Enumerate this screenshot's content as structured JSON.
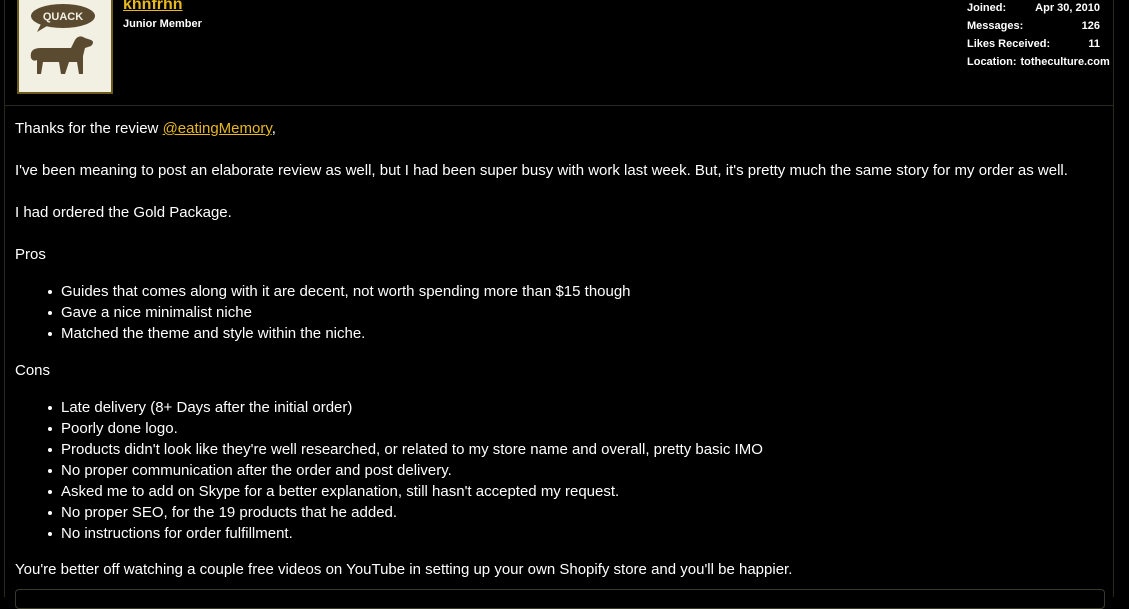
{
  "user": {
    "username": "khnfrhn",
    "title": "Junior Member",
    "avatar_label": "QUACK",
    "stats": {
      "joined_label": "Joined:",
      "joined_value": "Apr 30, 2010",
      "messages_label": "Messages:",
      "messages_value": "126",
      "likes_label": "Likes Received:",
      "likes_value": "11",
      "location_label": "Location:",
      "location_value": "totheculture.com"
    }
  },
  "post": {
    "intro_prefix": "Thanks for the review ",
    "mention": "@eatingMemory",
    "intro_suffix": ",",
    "para1": "I've been meaning to post an elaborate review as well, but I had been super busy with work last week. But, it's pretty much the same story for my order as well.",
    "para2": "I had ordered the Gold Package.",
    "pros_heading": "Pros",
    "pros": [
      "Guides that comes along with it are decent, not worth spending more than $15 though",
      "Gave a nice minimalist niche",
      "Matched the theme and style within the niche."
    ],
    "cons_heading": "Cons",
    "cons": [
      "Late delivery (8+ Days after the initial order)",
      "Poorly done logo.",
      "Products didn't look like they're well researched, or related to my store name and overall, pretty basic IMO",
      "No proper communication after the order and post delivery.",
      "Asked me to add on Skype for a better explanation, still hasn't accepted my request.",
      "No proper SEO, for the 19 products that he added.",
      "No instructions for order fulfillment."
    ],
    "closing": "You're better off watching a couple free videos on YouTube in setting up your own Shopify store and you'll be happier."
  },
  "colors": {
    "accent": "#e8b820",
    "background": "#000000",
    "text": "#ffffff"
  }
}
